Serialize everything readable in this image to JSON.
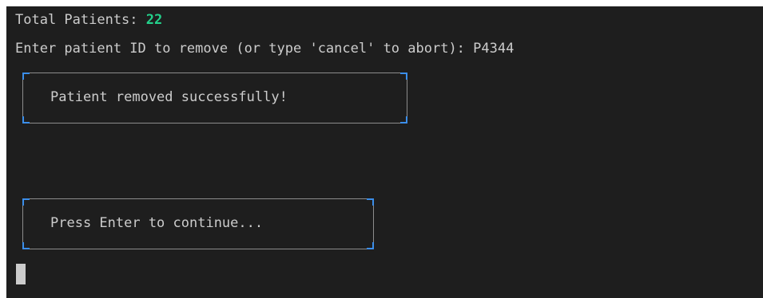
{
  "terminal": {
    "total_label": "Total Patients: ",
    "total_count": "22",
    "prompt_text": "Enter patient ID to remove (or type 'cancel' to abort): ",
    "prompt_input": "P4344",
    "success_message": "Patient removed successfully!",
    "continue_message": "Press Enter to continue...",
    "colors": {
      "background": "#1e1e1e",
      "text": "#cccccc",
      "count": "#23d18b",
      "box_corner": "#3b8eea"
    }
  }
}
